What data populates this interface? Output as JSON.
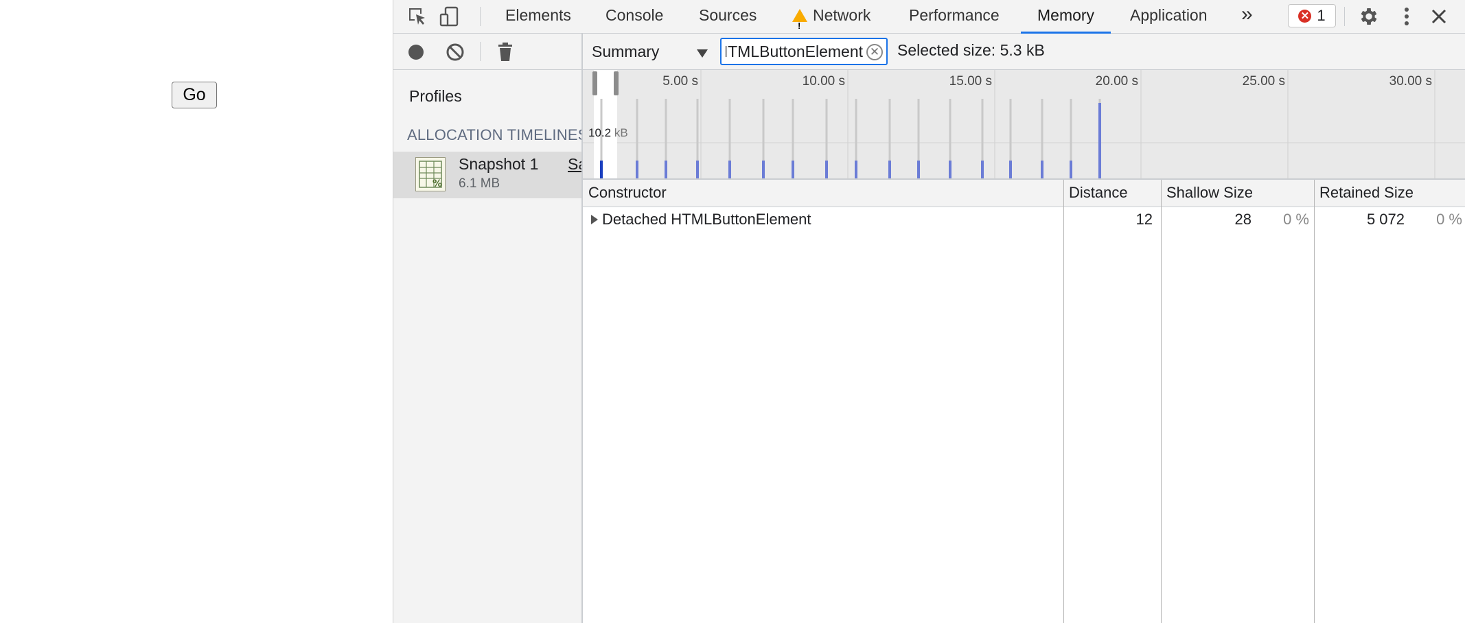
{
  "page": {
    "go_button": "Go"
  },
  "devtools": {
    "tabs": [
      {
        "label": "Elements"
      },
      {
        "label": "Console"
      },
      {
        "label": "Sources"
      },
      {
        "label": "Network",
        "warning": true
      },
      {
        "label": "Performance"
      },
      {
        "label": "Memory",
        "active": true
      },
      {
        "label": "Application"
      }
    ],
    "more_tabs": "»",
    "error_count": "1",
    "colors": {
      "accent": "#1a73e8",
      "error": "#d93025",
      "warning": "#f9ab00",
      "allocation_bar": "#6b7cd6"
    },
    "icons": [
      "inspect-element-icon",
      "device-toolbar-icon",
      "gear-icon",
      "kebab-menu-icon",
      "close-icon",
      "record-icon",
      "clear-icon",
      "trash-icon",
      "heap-snapshot-icon"
    ]
  },
  "profiles": {
    "heading": "Profiles",
    "section": "ALLOCATION TIMELINES",
    "snapshot": {
      "title": "Snapshot 1",
      "size": "6.1 MB",
      "save_link": "Save"
    }
  },
  "memory": {
    "view_selector": "Summary",
    "filter_value": "Detached HTMLButtonElement",
    "selected_size": "Selected size: 5.3 kB",
    "timeline": {
      "tick_labels": [
        "5.00 s",
        "10.00 s",
        "15.00 s",
        "20.00 s",
        "25.00 s",
        "30.00 s"
      ],
      "peak_value": "10.2",
      "peak_unit": "kB"
    },
    "table": {
      "columns": [
        "Constructor",
        "Distance",
        "Shallow Size",
        "Retained Size"
      ],
      "rows": [
        {
          "constructor": "Detached HTMLButtonElement",
          "distance": "12",
          "shallow": "28",
          "shallow_pct": "0 %",
          "retained": "5 072",
          "retained_pct": "0 %"
        }
      ]
    }
  }
}
